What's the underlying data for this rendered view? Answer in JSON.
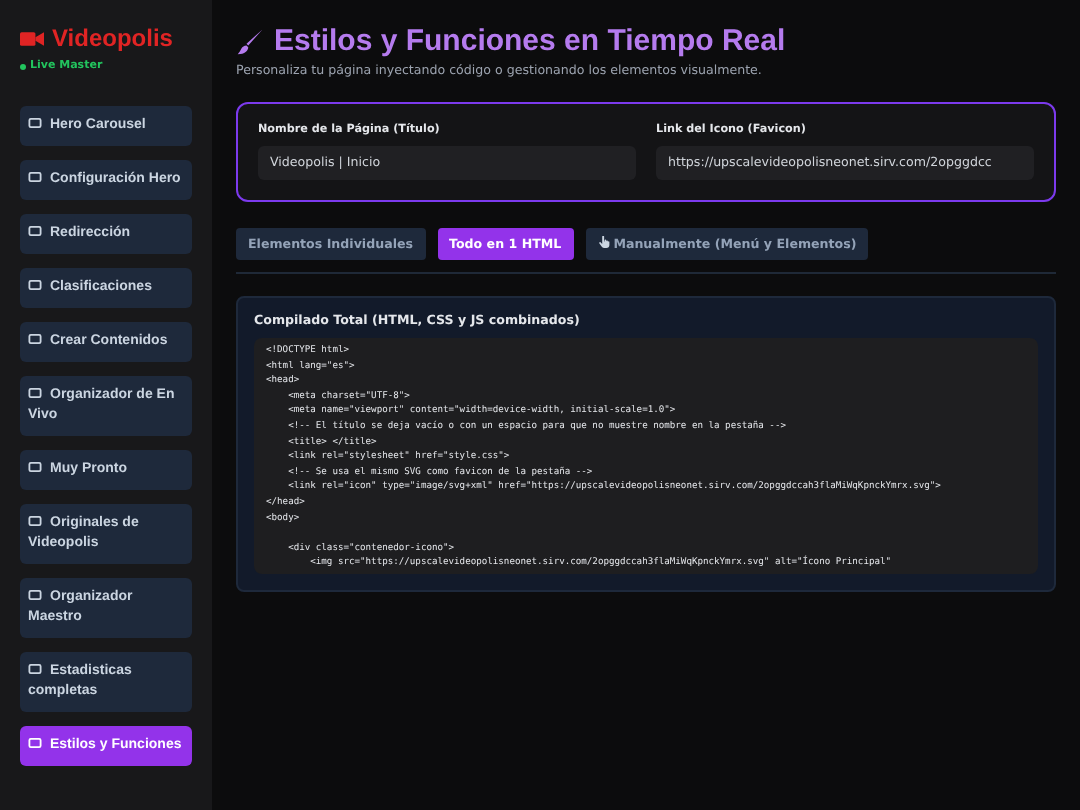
{
  "brand": {
    "name": "Videopolis",
    "status": "Live Master"
  },
  "sidebar": {
    "items": [
      {
        "label": "Hero Carousel",
        "selected": false
      },
      {
        "label": "Configuración Hero",
        "selected": false
      },
      {
        "label": "Redirección",
        "selected": false
      },
      {
        "label": "Clasificaciones",
        "selected": false
      },
      {
        "label": "Crear Contenidos",
        "selected": false
      },
      {
        "label": "Organizador de En Vivo",
        "selected": false
      },
      {
        "label": "Muy Pronto",
        "selected": false
      },
      {
        "label": "Originales de Videopolis",
        "selected": false
      },
      {
        "label": "Organizador Maestro",
        "selected": false
      },
      {
        "label": "Estadisticas completas",
        "selected": false
      },
      {
        "label": "Estilos y Funciones",
        "selected": true
      }
    ]
  },
  "header": {
    "title": "Estilos y Funciones en Tiempo Real",
    "subtitle": "Personaliza tu página inyectando código o gestionando los elementos visualmente."
  },
  "settings": {
    "fields": [
      {
        "label": "Nombre de la Página (Título)",
        "value": "Videopolis | Inicio"
      },
      {
        "label": "Link del Icono (Favicon)",
        "value": "https://upscalevideopolisneonet.sirv.com/2opggdcc"
      }
    ]
  },
  "tabs": [
    {
      "label": "Elementos Individuales",
      "selected": false
    },
    {
      "label": "Todo en 1 HTML",
      "selected": true
    },
    {
      "label": "Manualmente (Menú y Elementos)",
      "selected": false
    }
  ],
  "compiled": {
    "label": "Compilado Total (HTML, CSS y JS combinados)",
    "code": "<!DOCTYPE html>\n<html lang=\"es\">\n<head>\n    <meta charset=\"UTF-8\">\n    <meta name=\"viewport\" content=\"width=device-width, initial-scale=1.0\">\n    <!-- El título se deja vacío o con un espacio para que no muestre nombre en la pestaña -->\n    <title> </title>\n    <link rel=\"stylesheet\" href=\"style.css\">\n    <!-- Se usa el mismo SVG como favicon de la pestaña -->\n    <link rel=\"icon\" type=\"image/svg+xml\" href=\"https://upscalevideopolisneonet.sirv.com/2opggdccah3flaMiWqKpnckYmrx.svg\">\n</head>\n<body>\n\n    <div class=\"contenedor-icono\">\n        <img src=\"https://upscalevideopolisneonet.sirv.com/2opggdccah3flaMiWqKpnckYmrx.svg\" alt=\"Ícono Principal\""
  }
}
